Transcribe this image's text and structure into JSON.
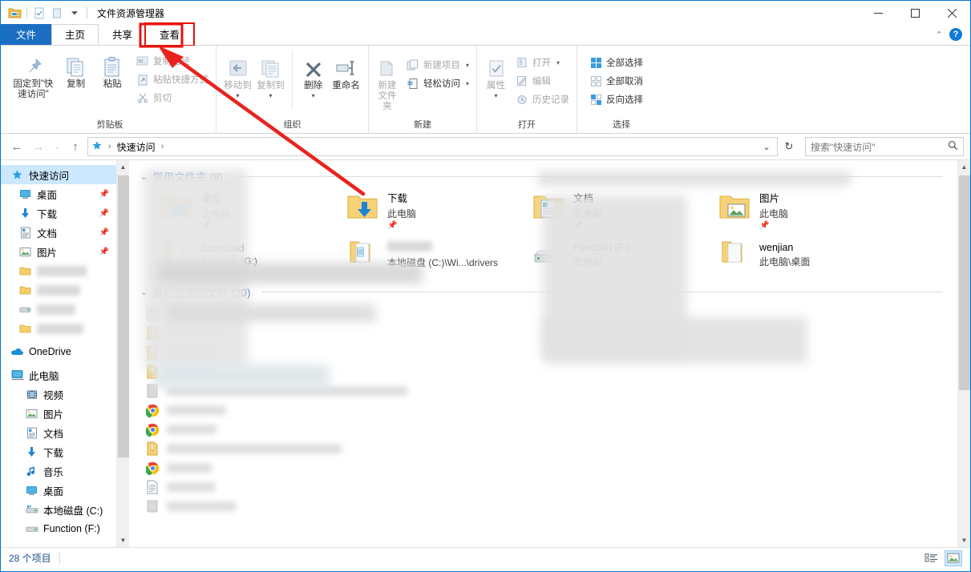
{
  "window": {
    "title": "文件资源管理器",
    "controls": {
      "minimize": "—",
      "maximize": "▢",
      "close": "✕"
    },
    "quick_access_toolbar": [
      "folder-icon",
      "properties-icon",
      "new-folder-icon",
      "dropdown-icon"
    ]
  },
  "tabs": [
    {
      "label": "文件",
      "name": "tab-file",
      "state": "file-menu"
    },
    {
      "label": "主页",
      "name": "tab-home",
      "state": "active"
    },
    {
      "label": "共享",
      "name": "tab-share",
      "state": "normal"
    },
    {
      "label": "查看",
      "name": "tab-view",
      "state": "highlighted"
    }
  ],
  "ribbon": {
    "collapse_icon": "chevron-up-icon",
    "help_icon": "help-icon",
    "groups": [
      {
        "title": "剪贴板",
        "big_buttons": [
          {
            "label": "固定到\"快\n速访问\"",
            "line1": "固定到\"快",
            "line2": "速访问\"",
            "icon": "pin-icon"
          },
          {
            "label": "复制",
            "icon": "copy-icon"
          },
          {
            "label": "粘贴",
            "icon": "paste-icon"
          }
        ],
        "small_buttons": [
          {
            "label": "复制路径",
            "icon": "copy-path-icon",
            "dim": true
          },
          {
            "label": "粘贴快捷方式",
            "icon": "paste-shortcut-icon",
            "dim": true
          },
          {
            "label": "剪切",
            "icon": "scissors-icon",
            "dim": true
          }
        ]
      },
      {
        "title": "组织",
        "big_buttons": [
          {
            "label": "移动到",
            "icon": "move-to-icon",
            "dim": true,
            "caret": true
          },
          {
            "label": "复制到",
            "icon": "copy-to-icon",
            "dim": true,
            "caret": true
          },
          {
            "label": "删除",
            "icon": "delete-icon",
            "caret": true
          },
          {
            "label": "重命名",
            "icon": "rename-icon"
          }
        ]
      },
      {
        "title": "新建",
        "big_buttons": [
          {
            "line1": "新建",
            "line2": "文件夹",
            "icon": "new-folder-icon",
            "dim": true
          }
        ],
        "small_buttons": [
          {
            "label": "新建项目",
            "icon": "new-item-icon",
            "dim": true,
            "caret": true
          },
          {
            "label": "轻松访问",
            "icon": "easy-access-icon",
            "caret": true
          }
        ]
      },
      {
        "title": "打开",
        "big_buttons": [
          {
            "label": "属性",
            "icon": "properties-icon",
            "dim": true,
            "caret": true
          }
        ],
        "small_buttons": [
          {
            "label": "打开",
            "icon": "open-icon",
            "dim": true,
            "caret": true
          },
          {
            "label": "编辑",
            "icon": "edit-icon",
            "dim": true
          },
          {
            "label": "历史记录",
            "icon": "history-icon",
            "dim": true
          }
        ]
      },
      {
        "title": "选择",
        "small_buttons": [
          {
            "label": "全部选择",
            "icon": "select-all-icon"
          },
          {
            "label": "全部取消",
            "icon": "select-none-icon"
          },
          {
            "label": "反向选择",
            "icon": "invert-selection-icon"
          }
        ]
      }
    ]
  },
  "addressbar": {
    "back_icon": "back-arrow-icon",
    "forward_icon": "forward-arrow-icon",
    "recent_icon": "chevron-down-icon",
    "up_icon": "up-arrow-icon",
    "crumb_icon": "quick-access-star-icon",
    "crumb": "快速访问",
    "dropdown_icon": "chevron-down-icon",
    "refresh_icon": "refresh-icon",
    "search_placeholder": "搜索\"快速访问\"",
    "search_value": "",
    "search_icon": "magnifier-icon"
  },
  "sidebar": {
    "items": [
      {
        "label": "快速访问",
        "icon": "quick-access-star-icon",
        "indent": 0,
        "selected": true
      },
      {
        "label": "桌面",
        "icon": "desktop-icon",
        "indent": 1,
        "pinned": true
      },
      {
        "label": "下载",
        "icon": "downloads-icon",
        "indent": 1,
        "pinned": true
      },
      {
        "label": "文档",
        "icon": "documents-icon",
        "indent": 1,
        "pinned": true
      },
      {
        "label": "图片",
        "icon": "pictures-icon",
        "indent": 1,
        "pinned": true
      },
      {
        "label": "",
        "icon": "folder-icon",
        "indent": 1,
        "blurred": true
      },
      {
        "label": "",
        "icon": "folder-icon",
        "indent": 1,
        "blurred": true
      },
      {
        "label": "",
        "icon": "drive-icon",
        "indent": 1,
        "blurred": true
      },
      {
        "label": "",
        "icon": "folder-icon",
        "indent": 1,
        "blurred": true
      },
      {
        "label": "OneDrive",
        "icon": "onedrive-icon",
        "indent": 0
      },
      {
        "label": "此电脑",
        "icon": "this-pc-icon",
        "indent": 0
      },
      {
        "label": "视频",
        "icon": "videos-icon",
        "indent": 1
      },
      {
        "label": "图片",
        "icon": "pictures-icon",
        "indent": 1
      },
      {
        "label": "文档",
        "icon": "documents-icon",
        "indent": 1
      },
      {
        "label": "下载",
        "icon": "downloads-icon",
        "indent": 1
      },
      {
        "label": "音乐",
        "icon": "music-icon",
        "indent": 1
      },
      {
        "label": "桌面",
        "icon": "desktop-icon",
        "indent": 1
      },
      {
        "label": "本地磁盘 (C:)",
        "icon": "local-disk-icon",
        "indent": 1
      },
      {
        "label": "Function (F:)",
        "icon": "drive-icon",
        "indent": 1
      }
    ]
  },
  "main": {
    "frequent_folders": {
      "header": "常用文件夹 (8)",
      "chevron": "chevron-down-icon",
      "items": [
        {
          "name": "桌面",
          "sub": "此电脑",
          "icon": "desktop-folder-icon",
          "pinned": true
        },
        {
          "name": "下载",
          "sub": "此电脑",
          "icon": "downloads-folder-icon",
          "pinned": true
        },
        {
          "name": "文档",
          "sub": "此电脑",
          "icon": "documents-folder-icon",
          "pinned": true
        },
        {
          "name": "图片",
          "sub": "此电脑",
          "icon": "pictures-folder-icon",
          "pinned": true
        },
        {
          "name": "download",
          "sub": "Backups (G:)",
          "icon": "folder-icon",
          "pinned": false
        },
        {
          "name": "",
          "sub": "本地磁盘 (C:)\\Wi...\\drivers",
          "icon": "folder-icon",
          "pinned": false,
          "name_blurred": true
        },
        {
          "name": "Function (F:)",
          "sub": "此电脑",
          "icon": "drive-icon",
          "pinned": false
        },
        {
          "name": "wenjian",
          "sub": "此电脑\\桌面",
          "icon": "folder-icon",
          "pinned": false
        }
      ]
    },
    "recent_files": {
      "header": "最近使用的文件 (20)",
      "chevron": "chevron-down-icon",
      "rows": [
        {
          "icon": "html-file-icon",
          "blurred": true
        },
        {
          "icon": "zip-file-icon",
          "blurred": true
        },
        {
          "icon": "zip-file-icon",
          "blurred": true
        },
        {
          "icon": "zip-file-icon",
          "blurred": true
        },
        {
          "icon": "generic-file-icon",
          "blurred": true
        },
        {
          "icon": "chrome-icon",
          "blurred": true
        },
        {
          "icon": "chrome-icon",
          "blurred": true
        },
        {
          "icon": "zip-file-icon",
          "blurred": true
        },
        {
          "icon": "chrome-icon",
          "blurred": true
        },
        {
          "icon": "text-file-icon",
          "blurred": true
        },
        {
          "icon": "generic-file-icon",
          "blurred": true
        }
      ]
    }
  },
  "statusbar": {
    "item_count": "28 个项目",
    "view_details_icon": "details-view-icon",
    "view_large_icons_icon": "large-icons-view-icon"
  },
  "annotation": {
    "arrow_color": "#e8231f",
    "box_color": "#e8100f",
    "target_label": "查看"
  }
}
